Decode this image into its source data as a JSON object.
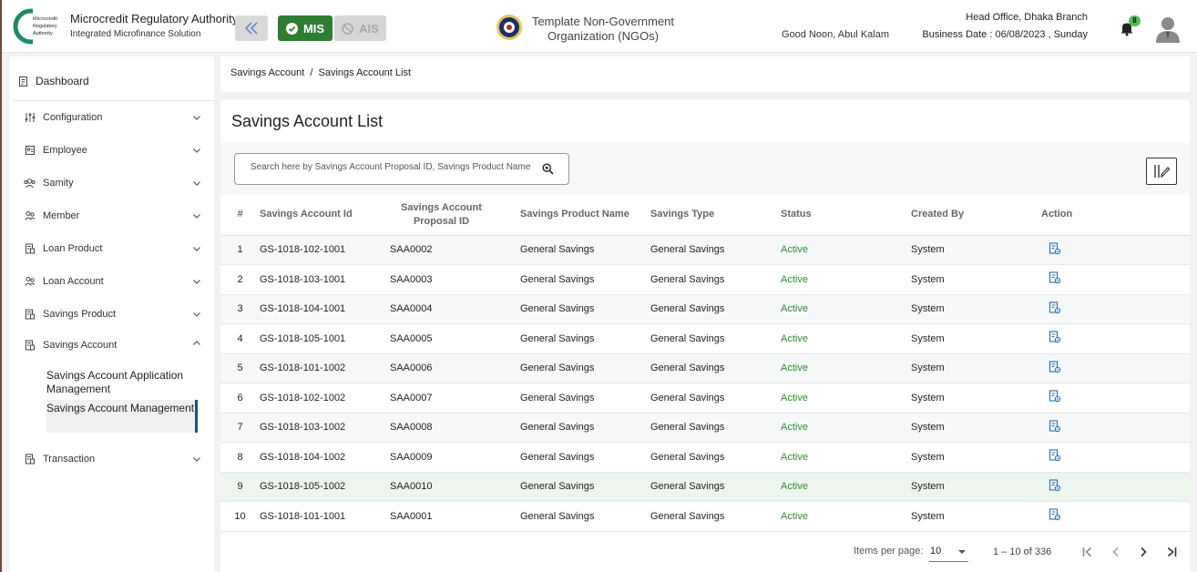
{
  "header": {
    "logo_text": "Microcredit Regulatory Authority",
    "app_title": "Microcredit Regulatory Authority",
    "app_subtitle": "Integrated Microfinance Solution",
    "mode_mis": "MIS",
    "mode_ais": "AIS",
    "org_name": "Template Non-Government Organization (NGOs)",
    "greeting": "Good Noon, Abul Kalam",
    "branch": "Head Office, Dhaka Branch",
    "business_date": "Business Date : 06/08/2023 , Sunday",
    "notification_count": "8"
  },
  "sidebar": {
    "dashboard": "Dashboard",
    "items": [
      {
        "label": "Configuration",
        "icon": "sliders-icon"
      },
      {
        "label": "Employee",
        "icon": "id-card-icon"
      },
      {
        "label": "Samity",
        "icon": "group-icon"
      },
      {
        "label": "Member",
        "icon": "members-icon"
      },
      {
        "label": "Loan Product",
        "icon": "document-icon"
      },
      {
        "label": "Loan Account",
        "icon": "members-icon"
      },
      {
        "label": "Savings Product",
        "icon": "document-icon"
      },
      {
        "label": "Savings Account",
        "icon": "document-icon"
      },
      {
        "label": "Transaction",
        "icon": "document-icon"
      }
    ],
    "sub_items": [
      "Savings Account Application Management",
      "Savings Account Management"
    ]
  },
  "breadcrumb": {
    "parent": "Savings Account",
    "separator": "/",
    "current": "Savings Account List"
  },
  "main": {
    "title": "Savings Account List",
    "search_placeholder": "Search here by Savings Account Proposal ID, Savings Product Name"
  },
  "table": {
    "headers": [
      "#",
      "Savings Account Id",
      "Savings Account Proposal ID",
      "Savings Product Name",
      "Savings Type",
      "Status",
      "Created By",
      "Action"
    ],
    "rows": [
      {
        "n": "1",
        "id": "GS-1018-102-1001",
        "proposal": "SAA0002",
        "product": "General Savings",
        "type": "General Savings",
        "status": "Active",
        "by": "System"
      },
      {
        "n": "2",
        "id": "GS-1018-103-1001",
        "proposal": "SAA0003",
        "product": "General Savings",
        "type": "General Savings",
        "status": "Active",
        "by": "System"
      },
      {
        "n": "3",
        "id": "GS-1018-104-1001",
        "proposal": "SAA0004",
        "product": "General Savings",
        "type": "General Savings",
        "status": "Active",
        "by": "System"
      },
      {
        "n": "4",
        "id": "GS-1018-105-1001",
        "proposal": "SAA0005",
        "product": "General Savings",
        "type": "General Savings",
        "status": "Active",
        "by": "System"
      },
      {
        "n": "5",
        "id": "GS-1018-101-1002",
        "proposal": "SAA0006",
        "product": "General Savings",
        "type": "General Savings",
        "status": "Active",
        "by": "System"
      },
      {
        "n": "6",
        "id": "GS-1018-102-1002",
        "proposal": "SAA0007",
        "product": "General Savings",
        "type": "General Savings",
        "status": "Active",
        "by": "System"
      },
      {
        "n": "7",
        "id": "GS-1018-103-1002",
        "proposal": "SAA0008",
        "product": "General Savings",
        "type": "General Savings",
        "status": "Active",
        "by": "System"
      },
      {
        "n": "8",
        "id": "GS-1018-104-1002",
        "proposal": "SAA0009",
        "product": "General Savings",
        "type": "General Savings",
        "status": "Active",
        "by": "System"
      },
      {
        "n": "9",
        "id": "GS-1018-105-1002",
        "proposal": "SAA0010",
        "product": "General Savings",
        "type": "General Savings",
        "status": "Active",
        "by": "System"
      },
      {
        "n": "10",
        "id": "GS-1018-101-1001",
        "proposal": "SAA0001",
        "product": "General Savings",
        "type": "General Savings",
        "status": "Active",
        "by": "System"
      }
    ]
  },
  "paginator": {
    "items_per_page_label": "Items per page:",
    "items_per_page": "10",
    "range": "1 – 10 of 336"
  },
  "colors": {
    "mis_green": "#2e7d32",
    "status_active": "#2e8b2e",
    "action_icon": "#2b6cb0"
  }
}
